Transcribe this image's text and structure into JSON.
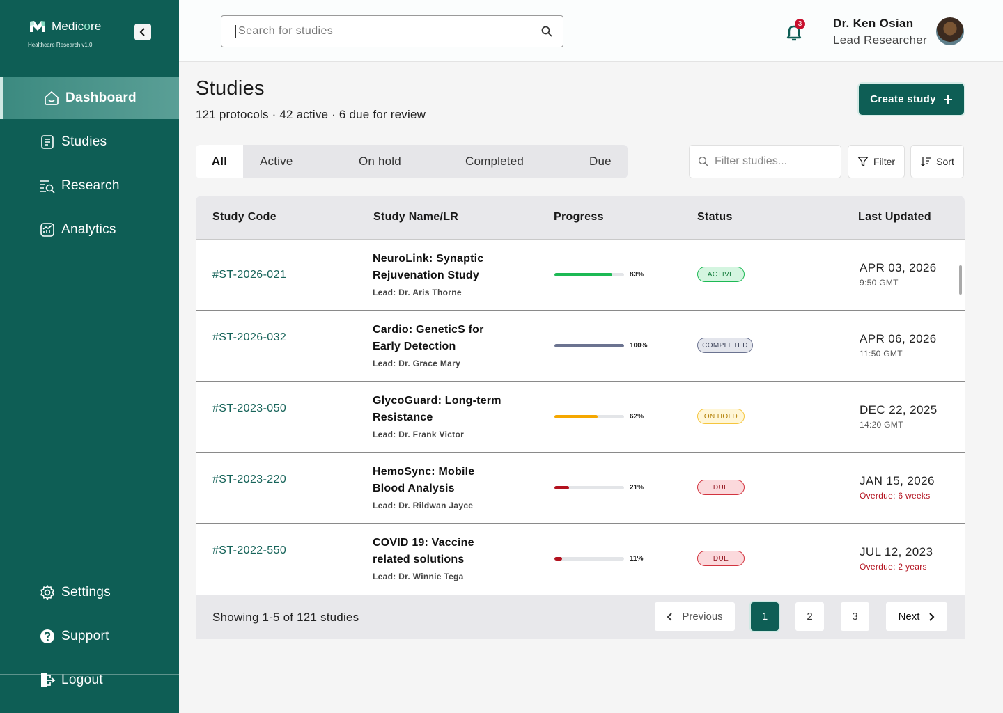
{
  "brand": {
    "name_main": "Medic",
    "name_accent": "o",
    "name_tail": "re",
    "subtitle": "Healthcare Research v1.0"
  },
  "sidebar": {
    "items": [
      {
        "label": "Dashboard",
        "icon": "home-icon",
        "active": true
      },
      {
        "label": "Studies",
        "icon": "document-icon",
        "active": false
      },
      {
        "label": "Research",
        "icon": "search-list-icon",
        "active": false
      },
      {
        "label": "Analytics",
        "icon": "chart-icon",
        "active": false
      }
    ],
    "bottom": [
      {
        "label": "Settings",
        "icon": "gear-icon"
      },
      {
        "label": "Support",
        "icon": "help-icon"
      },
      {
        "label": "Logout",
        "icon": "logout-icon"
      }
    ]
  },
  "topbar": {
    "search_placeholder": "Search for studies",
    "notification_count": "3",
    "user_name": "Dr. Ken Osian",
    "user_role": "Lead Researcher"
  },
  "page": {
    "title": "Studies",
    "subtitle": "121 protocols · 42 active · 6 due for review",
    "create_label": "Create study"
  },
  "tabs": [
    "All",
    "Active",
    "On hold",
    "Completed",
    "Due"
  ],
  "toolbar": {
    "filter_placeholder": "Filter studies...",
    "filter_label": "Filter",
    "sort_label": "Sort"
  },
  "table": {
    "headers": [
      "Study Code",
      "Study Name/LR",
      "Progress",
      "Status",
      "Last Updated"
    ],
    "rows": [
      {
        "code": "#ST-2026-021",
        "name": "NeuroLink: Synaptic Rejuvenation Study",
        "lead": "Lead: Dr. Aris Thorne",
        "progress": 83,
        "progress_label": "83%",
        "status": "ACTIVE",
        "date": "APR 03, 2026",
        "time": "9:50 GMT",
        "overdue": false
      },
      {
        "code": "#ST-2026-032",
        "name": "Cardio: GeneticS for Early Detection",
        "lead": "Lead: Dr. Grace Mary",
        "progress": 100,
        "progress_label": "100%",
        "status": "COMPLETED",
        "date": "APR 06, 2026",
        "time": "11:50 GMT",
        "overdue": false
      },
      {
        "code": "#ST-2023-050",
        "name": "GlycoGuard: Long-term Resistance",
        "lead": "Lead: Dr. Frank Victor",
        "progress": 62,
        "progress_label": "62%",
        "status": "ON HOLD",
        "date": "DEC 22, 2025",
        "time": "14:20 GMT",
        "overdue": false
      },
      {
        "code": "#ST-2023-220",
        "name": "HemoSync: Mobile Blood Analysis",
        "lead": "Lead: Dr. Rildwan Jayce",
        "progress": 21,
        "progress_label": "21%",
        "status": "DUE",
        "date": "JAN 15, 2026",
        "time": "Overdue: 6 weeks",
        "overdue": true
      },
      {
        "code": "#ST-2022-550",
        "name": "COVID 19: Vaccine related solutions",
        "lead": "Lead: Dr. Winnie Tega",
        "progress": 11,
        "progress_label": "11%",
        "status": "DUE",
        "date": "JUL 12, 2023",
        "time": "Overdue: 2 years",
        "overdue": true
      }
    ]
  },
  "pagination": {
    "showing": "Showing 1-5 of 121 studies",
    "previous": "Previous",
    "pages": [
      "1",
      "2",
      "3"
    ],
    "current": "1",
    "next": "Next"
  },
  "colors": {
    "brand": "#0e5e55",
    "active": "#1db954",
    "completed": "#6b7390",
    "on_hold": "#f5a700",
    "due": "#b3121f"
  }
}
